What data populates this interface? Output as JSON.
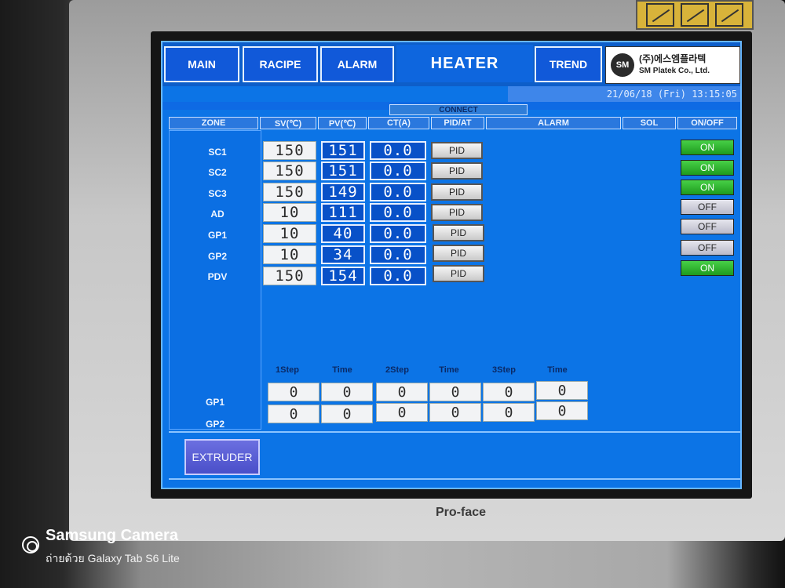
{
  "nav": {
    "main": "MAIN",
    "recipe": "RACIPE",
    "alarm": "ALARM",
    "title": "HEATER",
    "trend": "TREND"
  },
  "logo": {
    "mark": "SM",
    "korean": "(주)에스엠플라텍",
    "english": "SM Platek Co., Ltd."
  },
  "datetime": "21/06/18 (Fri) 13:15:05",
  "connect": "CONNECT",
  "columns": [
    "ZONE",
    "SV(℃)",
    "PV(℃)",
    "CT(A)",
    "PID/AT",
    "ALARM",
    "SOL",
    "ON/OFF"
  ],
  "zones": [
    {
      "name": "SC1",
      "sv": "150",
      "pv": "151",
      "ct": "0.0",
      "pid": "PID",
      "state": "ON"
    },
    {
      "name": "SC2",
      "sv": "150",
      "pv": "151",
      "ct": "0.0",
      "pid": "PID",
      "state": "ON"
    },
    {
      "name": "SC3",
      "sv": "150",
      "pv": "149",
      "ct": "0.0",
      "pid": "PID",
      "state": "ON"
    },
    {
      "name": "AD",
      "sv": "10",
      "pv": "111",
      "ct": "0.0",
      "pid": "PID",
      "state": "OFF"
    },
    {
      "name": "GP1",
      "sv": "10",
      "pv": "40",
      "ct": "0.0",
      "pid": "PID",
      "state": "OFF"
    },
    {
      "name": "GP2",
      "sv": "10",
      "pv": "34",
      "ct": "0.0",
      "pid": "PID",
      "state": "OFF"
    },
    {
      "name": "PDV",
      "sv": "150",
      "pv": "154",
      "ct": "0.0",
      "pid": "PID",
      "state": "ON"
    }
  ],
  "steps": {
    "headers": [
      "1Step",
      "Time",
      "2Step",
      "Time",
      "3Step",
      "Time"
    ],
    "rows": [
      {
        "label": "GP1",
        "values": [
          "0",
          "0",
          "0",
          "0",
          "0",
          "0"
        ]
      },
      {
        "label": "GP2",
        "values": [
          "0",
          "0",
          "0",
          "0",
          "0",
          "0"
        ]
      }
    ]
  },
  "extruder_button": "EXTRUDER",
  "device_brand": "Pro-face",
  "camera_overlay": {
    "title": "Samsung Camera",
    "subtitle": "ถ่ายด้วย Galaxy Tab S6 Lite"
  },
  "colors": {
    "screen_bg": "#0c74e6",
    "on_green": "#2bb52b",
    "off_grey": "#cfd0dc",
    "extruder_purple": "#5a5fd6"
  }
}
